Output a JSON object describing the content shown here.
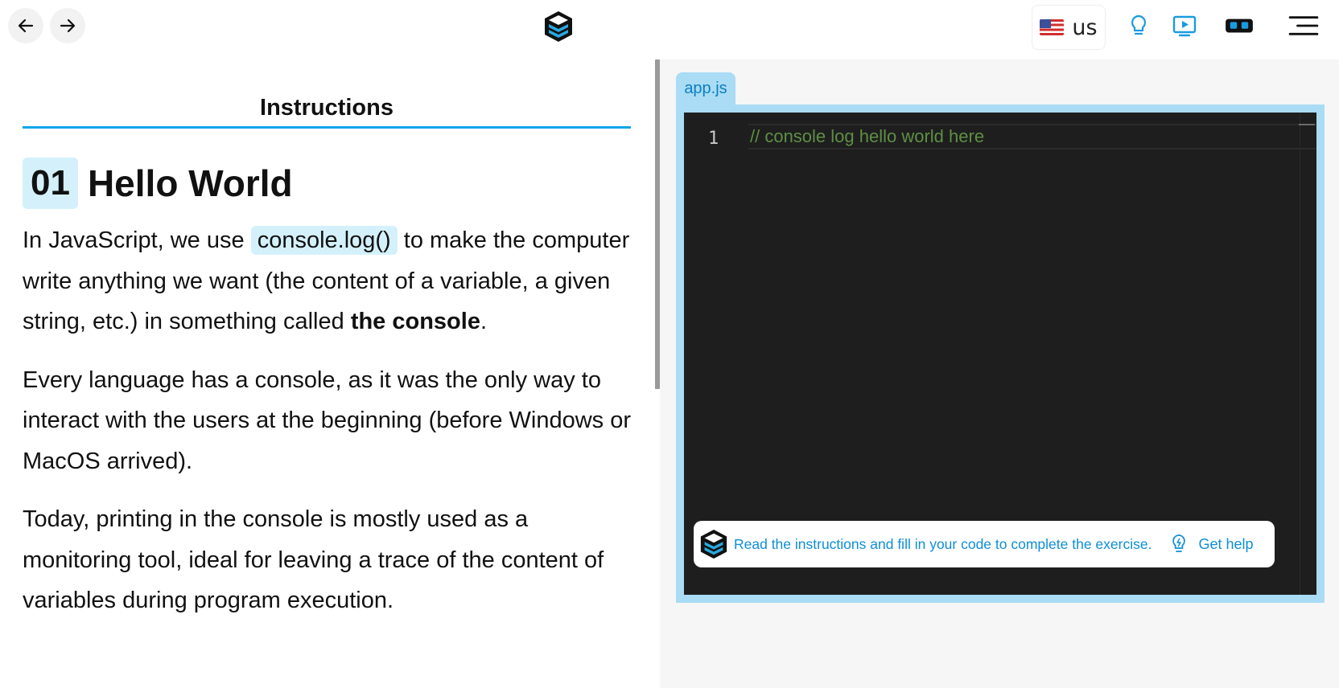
{
  "topbar": {
    "back_icon": "arrow-left-icon",
    "forward_icon": "arrow-right-icon",
    "logo_icon": "learnpack-logo",
    "language": {
      "flag": "us-flag-icon",
      "label": "us"
    },
    "icons": [
      "lightbulb-icon",
      "video-play-icon",
      "vr-headset-icon",
      "hamburger-menu-icon"
    ]
  },
  "instructions": {
    "tab_label": "Instructions",
    "lesson_number": "01",
    "lesson_title": "Hello World",
    "p1": {
      "before": "In JavaScript, we use ",
      "code": "console.log()",
      "after": " to make the computer write anything we want (the content of a variable, a given string, etc.) in something called ",
      "bold": "the console",
      "end": "."
    },
    "p2": "Every language has a console, as it was the only way to interact with the users at the beginning (before Windows or MacOS arrived).",
    "p3": "Today, printing in the console is mostly used as a monitoring tool, ideal for leaving a trace of the content of variables during program execution."
  },
  "editor": {
    "file_tab": "app.js",
    "line_number": "1",
    "code": "// console log hello world here",
    "hint_text": "Read the instructions and fill in your code to complete the exercise.",
    "help_label": "Get help"
  },
  "colors": {
    "accent": "#0ea5e9",
    "chip": "#d4f1fb",
    "editor_bg": "#1e1e1e",
    "editor_frame": "#aadcf5",
    "comment": "#5e8f45"
  }
}
